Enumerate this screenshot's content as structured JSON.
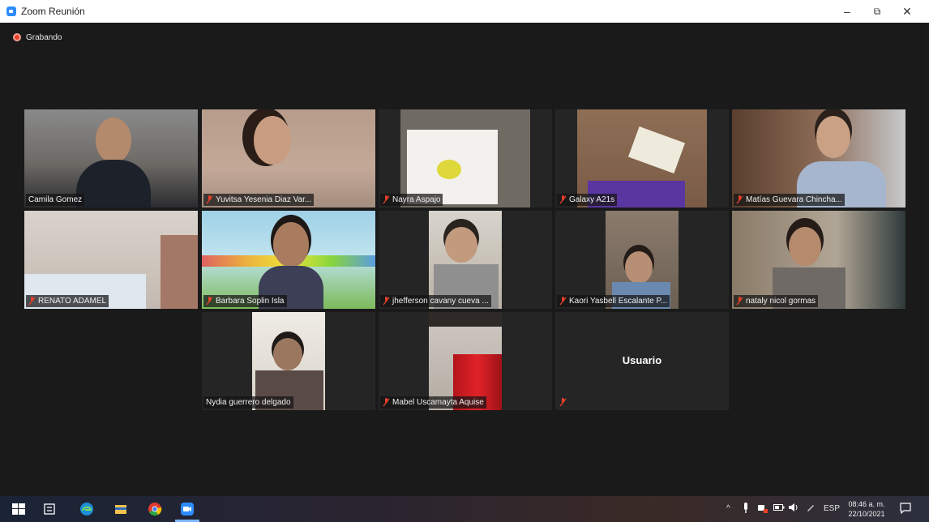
{
  "window": {
    "title": "Zoom Reunión",
    "minimize_icon": "–",
    "restore_icon": "⧉",
    "close_icon": "✕"
  },
  "recording": {
    "label": "Grabando",
    "color": "#e8402a"
  },
  "accent": {
    "active_speaker_border": "#d7e25b",
    "zoom_blue": "#2d8cff",
    "muted_icon": "#e8402a"
  },
  "participants": [
    {
      "name": "Camila Gomez",
      "muted": false,
      "active": true
    },
    {
      "name": "Yuvitsa Yesenia Diaz Var...",
      "muted": true
    },
    {
      "name": "Nayra Aspajo",
      "muted": true
    },
    {
      "name": "Galaxy A21s",
      "muted": true
    },
    {
      "name": "Matías Guevara Chincha...",
      "muted": true
    },
    {
      "name": "RENATO ADAMEL",
      "muted": true
    },
    {
      "name": "Barbara Soplin Isla",
      "muted": true
    },
    {
      "name": "jhefferson cavany cueva ...",
      "muted": true
    },
    {
      "name": "Kaori Yasbell Escalante P...",
      "muted": true
    },
    {
      "name": "nataly nicol gormas",
      "muted": true
    },
    {
      "name": "Nydia guerrero delgado",
      "muted": false
    },
    {
      "name": "Mabel Uscamayta Aquise",
      "muted": true
    },
    {
      "name": "",
      "muted": true,
      "video_off_label": "Usuario"
    }
  ],
  "taskbar": {
    "icons": [
      "windows-start-icon",
      "task-view-icon",
      "edge-icon",
      "file-explorer-icon",
      "chrome-icon",
      "zoom-icon"
    ],
    "tray": {
      "chevron": "^",
      "language": "ESP"
    },
    "time": "08:46 a. m.",
    "date": "22/10/2021"
  }
}
